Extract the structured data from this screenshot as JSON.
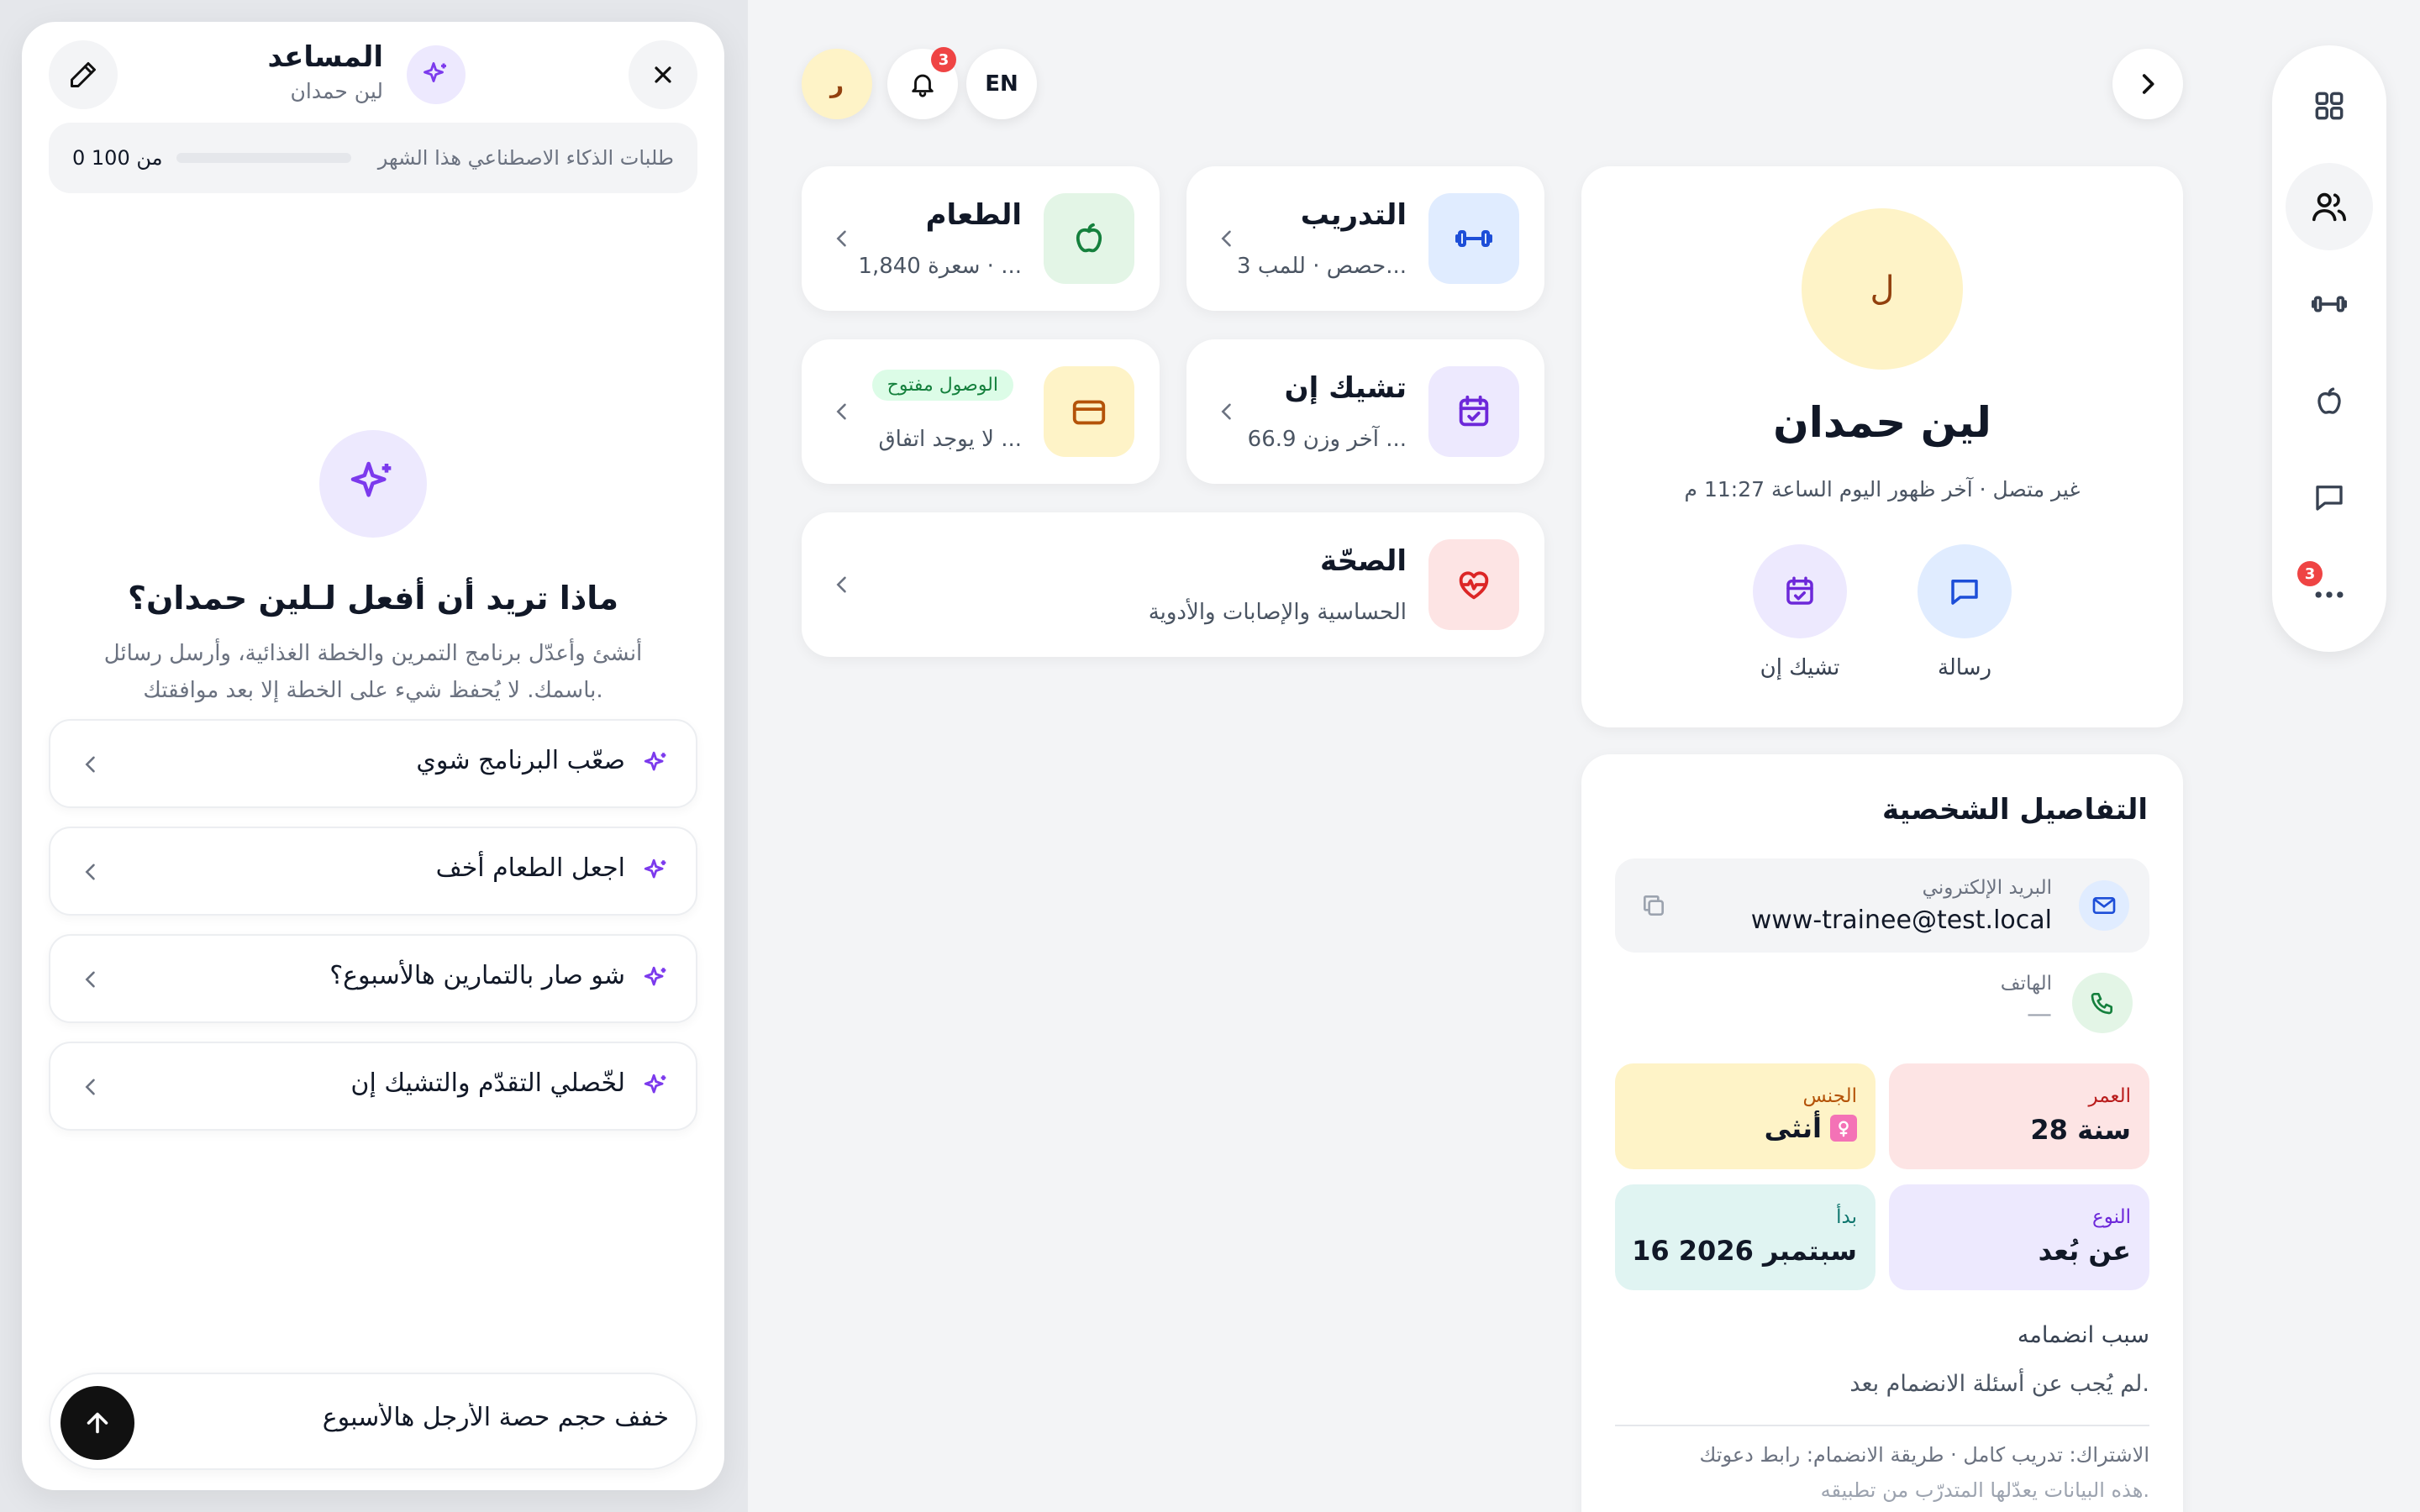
{
  "assistant": {
    "title": "المساعد",
    "subtitle": "لين حمدان",
    "usage_label": "طلبات الذكاء الاصطناعي هذا الشهر",
    "usage_count": "0 من 100",
    "usage_fraction": 0,
    "hero_title": "ماذا تريد أن أفعل لـلين حمدان؟",
    "hero_desc_1": "أنشئ وأعدّل برنامج التمرين والخطة الغذائية، وأرسل رسائل",
    "hero_desc_2": "باسمك. لا يُحفظ شيء على الخطة إلا بعد موافقتك.",
    "suggestions": [
      {
        "label": "صعّب البرنامج شوي"
      },
      {
        "label": "اجعل الطعام أخف"
      },
      {
        "label": "شو صار بالتمارين هالأسبوع؟"
      },
      {
        "label": "لخّصلي التقدّم والتشيك إن"
      }
    ],
    "composer_value": "خفف حجم حصة الأرجل هالأسبوع"
  },
  "topbar": {
    "lang": "EN",
    "notifications_count": "3",
    "avatar_initial": "ر"
  },
  "rail": {
    "more_badge": "3"
  },
  "cards": {
    "training": {
      "title": "التدريب",
      "sub": "3 حصص · للمب..."
    },
    "food": {
      "title": "الطعام",
      "sub": "1,840 سعرة · ..."
    },
    "checkin": {
      "title": "تشيك إن",
      "sub": "آخر وزن 66.9 ..."
    },
    "billing": {
      "pill": "الوصول مفتوح",
      "sub": "لا يوجد اتفاق ..."
    },
    "health": {
      "title": "الصحّة",
      "sub": "الحساسية والإصابات والأدوية"
    }
  },
  "profile": {
    "initial": "ل",
    "name": "لين حمدان",
    "status": "غير متصل · آخر ظهور اليوم الساعة 11:27 م",
    "message_label": "رسالة",
    "checkin_label": "تشيك إن"
  },
  "details": {
    "title": "التفاصيل الشخصية",
    "email_label": "البريد الإلكتروني",
    "email": "www-trainee@test.local",
    "phone_label": "الهاتف",
    "phone": "—",
    "age_label": "العمر",
    "age": "28 سنة",
    "gender_label": "الجنس",
    "gender": "أنثى",
    "type_label": "النوع",
    "type": "عن بُعد",
    "start_label": "بدأ",
    "start": "16 سبتمبر 2026",
    "join_reason_label": "سبب انضمامه",
    "join_reason": "لم يُجب عن أسئلة الانضمام بعد.",
    "subscription": "الاشتراك: تدريب كامل · طريقة الانضمام: رابط دعوتك",
    "footnote": "هذه البيانات يعدّلها المتدرّب من تطبيقه."
  },
  "colors": {
    "accent": "#7c3aed",
    "badge": "#ef4444",
    "training_bg": "#e0ecff",
    "food_bg": "#e3f5e6",
    "checkin_bg": "#ede9fe",
    "billing_bg": "#fef3c7",
    "health_bg": "#fde4e4"
  }
}
